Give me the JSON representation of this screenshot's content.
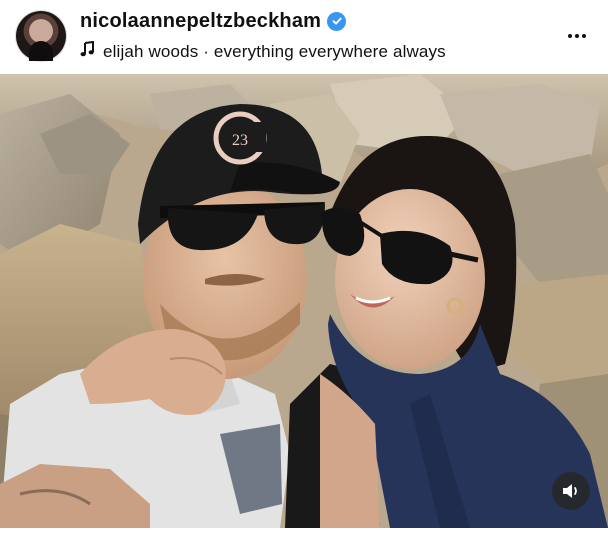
{
  "post": {
    "username": "nicolaannepeltzbeckham",
    "verified": true,
    "audio": "elijah woods · everything everywhere always",
    "icons": {
      "avatar": "profile-avatar",
      "verified": "verified-badge-icon",
      "music": "music-note-icon",
      "more": "more-options-icon",
      "volume": "speaker-volume-icon"
    }
  },
  "media": {
    "cap_logo": "23"
  },
  "colors": {
    "verified": "#3797f0",
    "text": "#111111",
    "volume_button_bg": "#262626"
  }
}
